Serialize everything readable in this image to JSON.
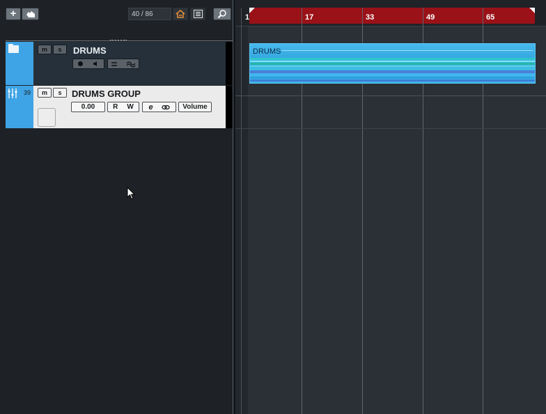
{
  "toolbar": {
    "add_track_label": "+",
    "counter": "40 / 86"
  },
  "tracks": [
    {
      "name": "DRUMS",
      "type": "folder",
      "mute_label": "m",
      "solo_label": "s",
      "icon": "folder-icon"
    },
    {
      "name": "DRUMS GROUP",
      "type": "group",
      "number": "39",
      "mute_label": "m",
      "solo_label": "s",
      "volume_value": "0.00",
      "read_label": "R",
      "write_label": "W",
      "automation_param": "Volume",
      "icon": "mixer-fader-icon"
    }
  ],
  "ruler": {
    "bars": [
      "1",
      "17",
      "33",
      "49",
      "65"
    ]
  },
  "events": [
    {
      "name": "DRUMS",
      "track": "DRUMS"
    }
  ],
  "colors": {
    "track_strip": "#3fa4e6",
    "cycle_region": "#9a1218",
    "event_fill": "#3db2ea",
    "active_toolbar_icon": "#e8913a"
  }
}
